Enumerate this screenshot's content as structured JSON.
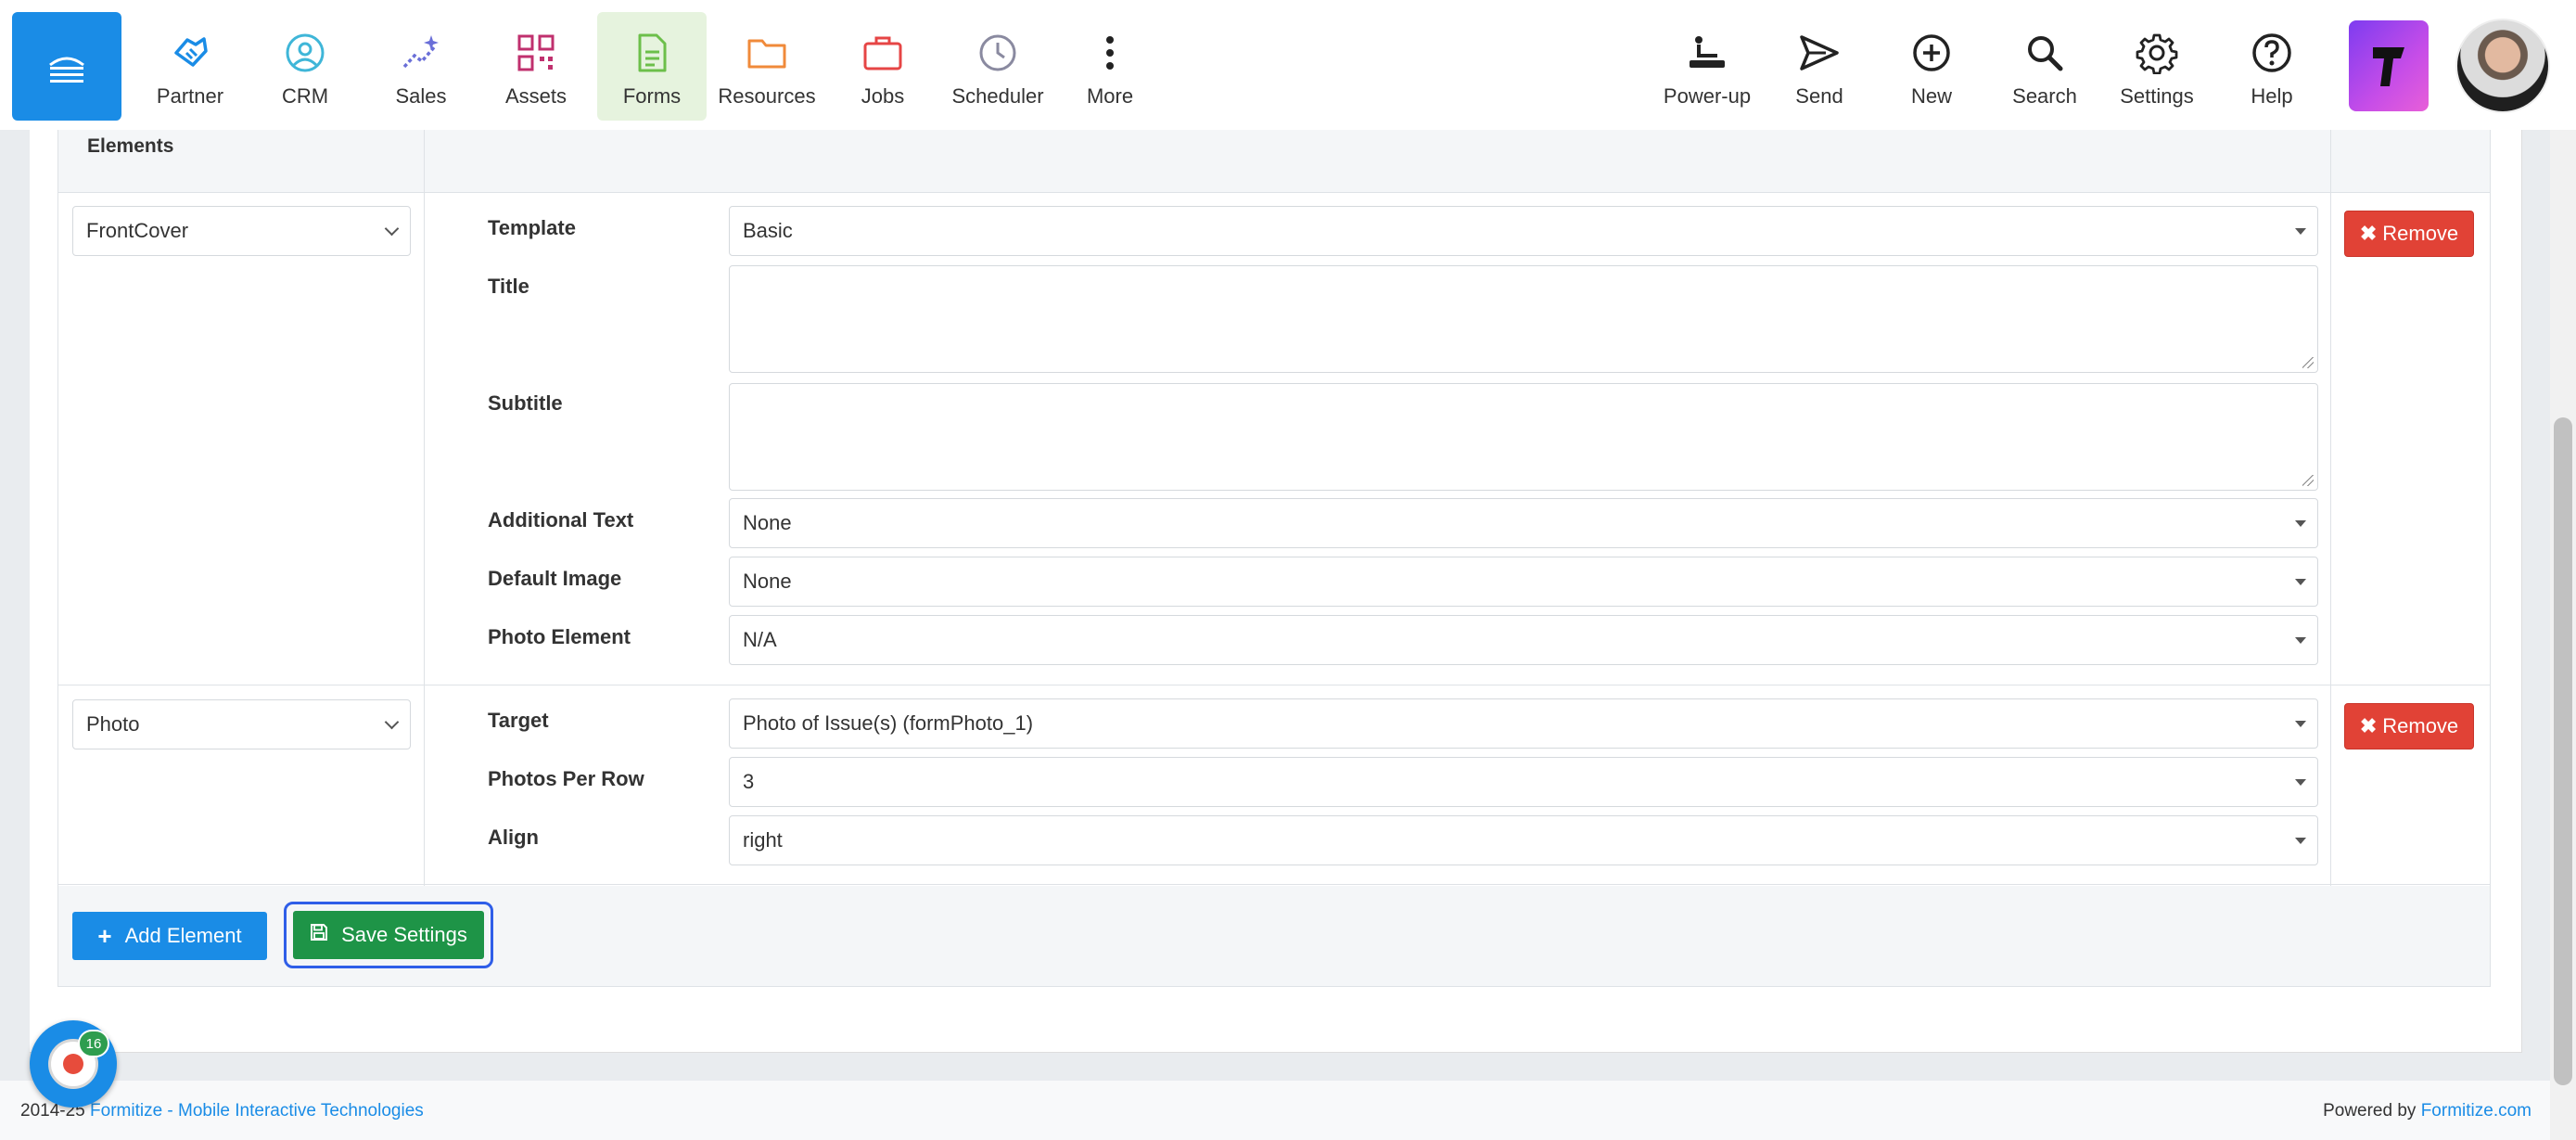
{
  "nav": {
    "items": [
      {
        "label": "Partner",
        "icon": "handshake-icon",
        "color": "#1a8ce6"
      },
      {
        "label": "CRM",
        "icon": "user-circle-icon",
        "color": "#3fb6d8"
      },
      {
        "label": "Sales",
        "icon": "sparkle-chart-icon",
        "color": "#6a6fd8"
      },
      {
        "label": "Assets",
        "icon": "qr-code-icon",
        "color": "#c0306e"
      },
      {
        "label": "Forms",
        "icon": "document-icon",
        "color": "#6cbf4a"
      },
      {
        "label": "Resources",
        "icon": "folder-icon",
        "color": "#f08a3a"
      },
      {
        "label": "Jobs",
        "icon": "briefcase-icon",
        "color": "#e64545"
      },
      {
        "label": "Scheduler",
        "icon": "clock-icon",
        "color": "#8a8aa0"
      },
      {
        "label": "More",
        "icon": "more-vertical-icon",
        "color": "#222222"
      }
    ],
    "right_items": [
      {
        "label": "Power-up",
        "icon": "power-up-icon"
      },
      {
        "label": "Send",
        "icon": "send-icon"
      },
      {
        "label": "New",
        "icon": "plus-circle-icon"
      },
      {
        "label": "Search",
        "icon": "search-icon"
      },
      {
        "label": "Settings",
        "icon": "gear-icon"
      },
      {
        "label": "Help",
        "icon": "help-circle-icon"
      }
    ],
    "active": "Forms"
  },
  "table": {
    "header": "Elements",
    "elements": [
      {
        "type": "FrontCover",
        "remove_label": "Remove",
        "fields": {
          "template": {
            "label": "Template",
            "value": "Basic"
          },
          "title": {
            "label": "Title",
            "value": ""
          },
          "subtitle": {
            "label": "Subtitle",
            "value": ""
          },
          "additional_text": {
            "label": "Additional Text",
            "value": "None"
          },
          "default_image": {
            "label": "Default Image",
            "value": "None"
          },
          "photo_element": {
            "label": "Photo Element",
            "value": "N/A"
          }
        }
      },
      {
        "type": "Photo",
        "remove_label": "Remove",
        "fields": {
          "target": {
            "label": "Target",
            "value": "Photo of Issue(s) (formPhoto_1)"
          },
          "photos_per_row": {
            "label": "Photos Per Row",
            "value": "3"
          },
          "align": {
            "label": "Align",
            "value": "right"
          }
        }
      }
    ],
    "add_label": "Add Element",
    "save_label": "Save Settings"
  },
  "footer": {
    "years": "2014-25",
    "company": "Formitize - Mobile Interactive Technologies",
    "powered_by": "Powered by",
    "site": "Formitize.com"
  },
  "recorder": {
    "badge": "16"
  },
  "colors": {
    "primary": "#1a8ce6",
    "danger": "#e14236",
    "success": "#1e9447",
    "focus": "#2f5ee8"
  }
}
